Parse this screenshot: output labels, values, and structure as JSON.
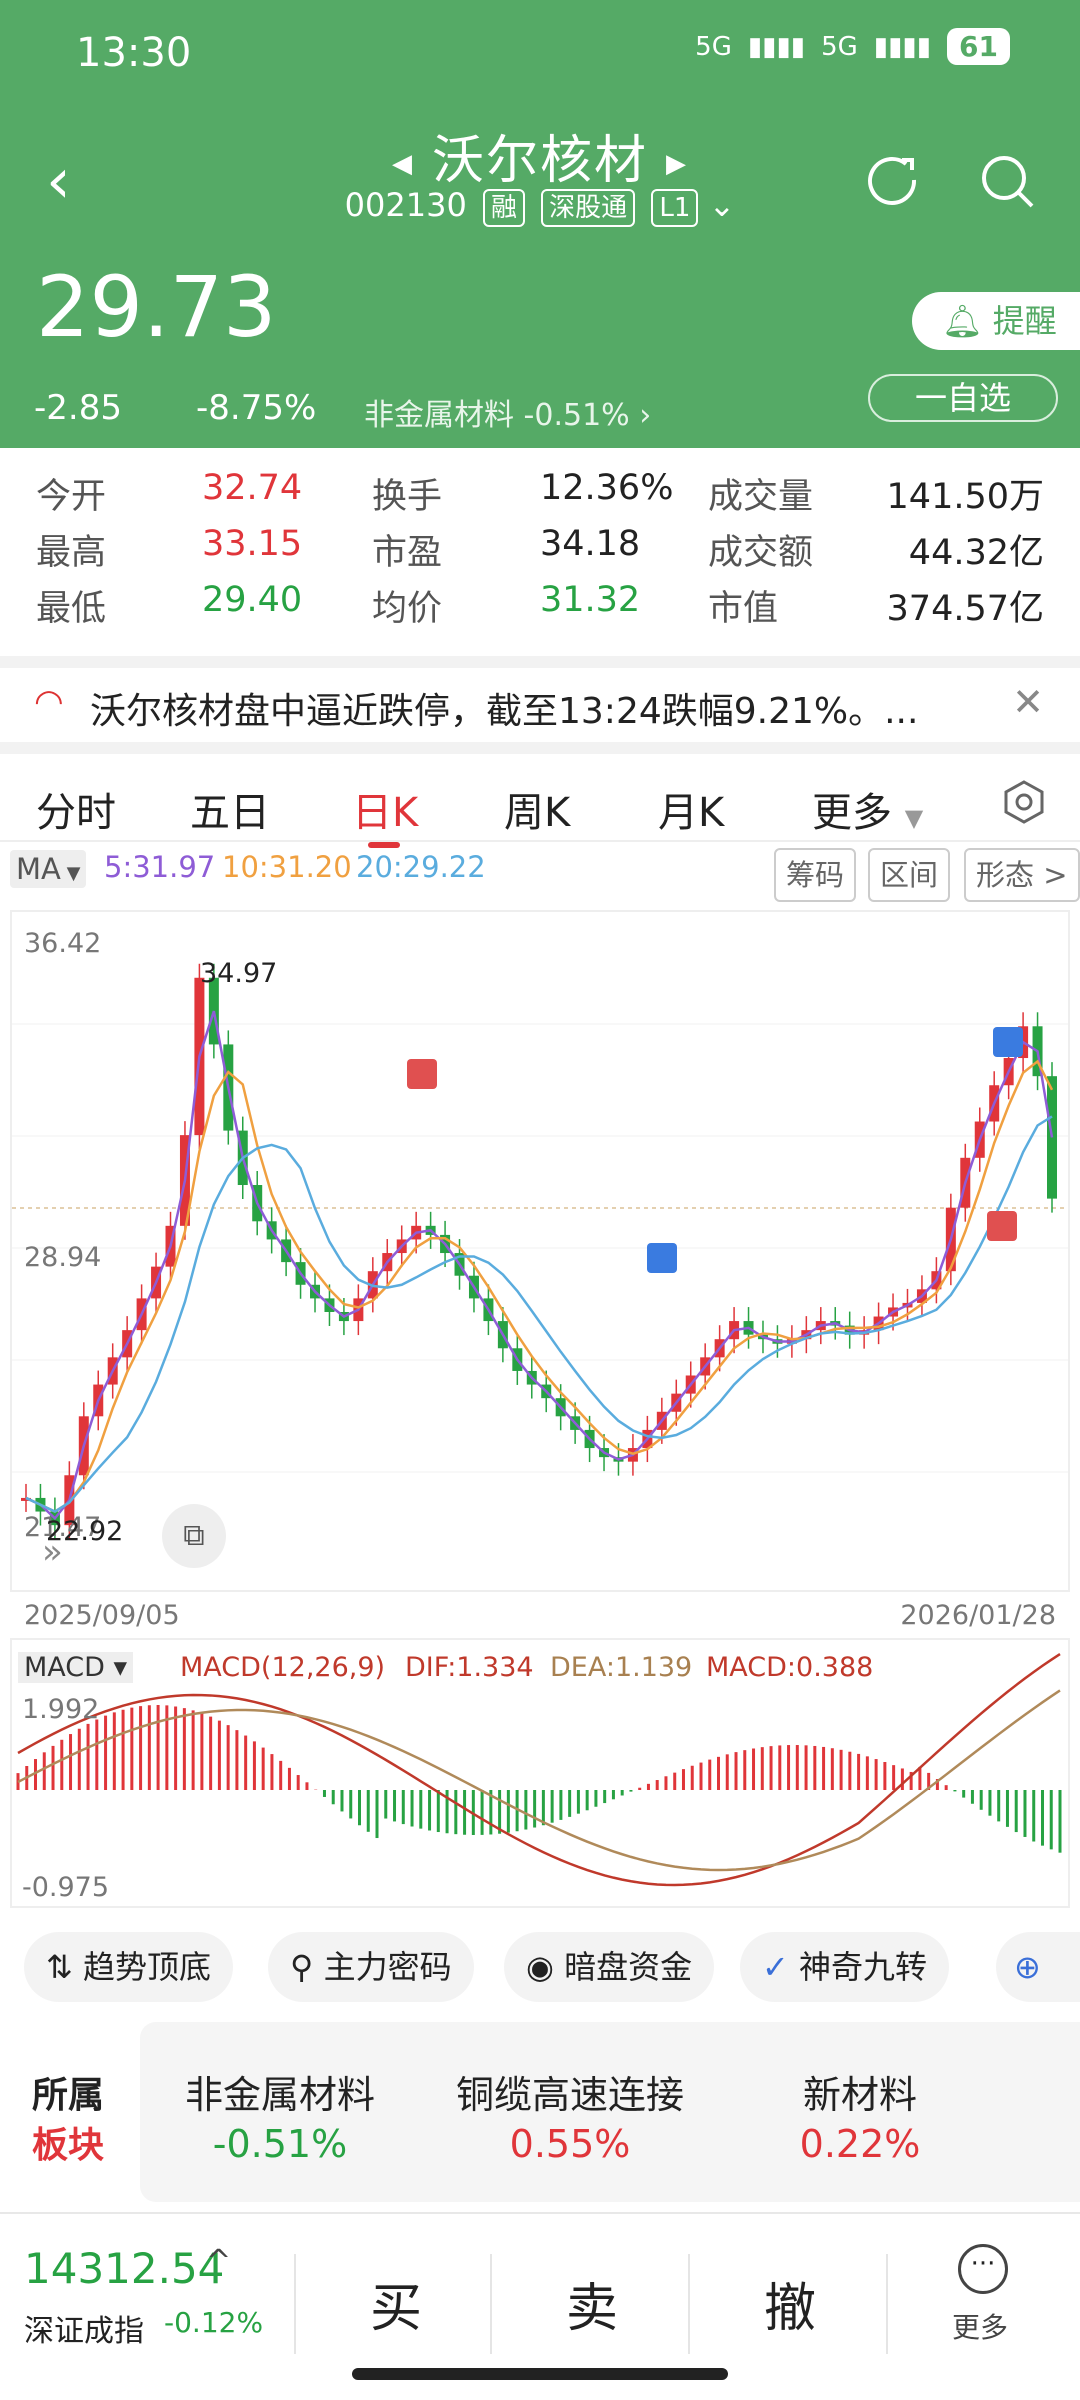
{
  "status_bar": {
    "time": "13:30",
    "signal1": "5G",
    "signal2": "5G",
    "battery": "61"
  },
  "header": {
    "stock_name": "沃尔核材",
    "code": "002130",
    "badges": [
      "融",
      "深股通",
      "L1"
    ],
    "price": "29.73",
    "change": "-2.85",
    "change_pct": "-8.75%",
    "industry": "非金属材料",
    "industry_pct": "-0.51%",
    "remind_label": "提醒",
    "watchlist_label": "一自选"
  },
  "stats": {
    "open_label": "今开",
    "open": "32.74",
    "turnover_label": "换手",
    "turnover": "12.36%",
    "volume_label": "成交量",
    "volume": "141.50万",
    "high_label": "最高",
    "high": "33.15",
    "pe_label": "市盈",
    "pe": "34.18",
    "amount_label": "成交额",
    "amount": "44.32亿",
    "low_label": "最低",
    "low": "29.40",
    "avg_label": "均价",
    "avg": "31.32",
    "mcap_label": "市值",
    "mcap": "374.57亿"
  },
  "news": {
    "text": "沃尔核材盘中逼近跌停，截至13:24跌幅9.21%。..."
  },
  "tabs": [
    "分时",
    "五日",
    "日K",
    "周K",
    "月K",
    "更多"
  ],
  "active_tab": "日K",
  "ma": {
    "label": "MA",
    "ma5": "5:31.97",
    "ma10": "10:31.20",
    "ma20": "20:29.22",
    "tools": [
      "筹码",
      "区间",
      "形态 >"
    ]
  },
  "colors": {
    "green": "#55aa66",
    "up": "#e0353a",
    "down": "#27a243",
    "ma5": "#8e5cd6",
    "ma10": "#f0a040",
    "ma20": "#5aacde"
  },
  "chart_data": {
    "type": "candlestick",
    "y_top_label": "36.42",
    "y_mid_label": "28.94",
    "y_bottom_label": "21.47",
    "ylim": [
      21.47,
      36.42
    ],
    "x_start": "2025/09/05",
    "x_end": "2026/01/28",
    "high_label": "34.97",
    "low_label": "22.92",
    "markers": [
      "S",
      "B",
      "S",
      "B"
    ]
  },
  "macd": {
    "label": "MACD",
    "params": "MACD(12,26,9)",
    "dif": "DIF:1.334",
    "dea": "DEA:1.139",
    "macd": "MACD:0.388",
    "y_top": "1.992",
    "y_bottom": "-0.975"
  },
  "indicators": [
    "趋势顶底",
    "主力密码",
    "暗盘资金",
    "神奇九转"
  ],
  "sectors": {
    "title_1": "所属",
    "title_2": "板块",
    "items": [
      {
        "name": "非金属材料",
        "pct": "-0.51%"
      },
      {
        "name": "铜缆高速连接",
        "pct": "0.55%"
      },
      {
        "name": "新材料",
        "pct": "0.22%"
      }
    ]
  },
  "bottom": {
    "index_value": "14312.54",
    "index_name": "深证成指",
    "index_pct": "-0.12%",
    "buy": "买",
    "sell": "卖",
    "cancel": "撤",
    "more": "更多"
  }
}
